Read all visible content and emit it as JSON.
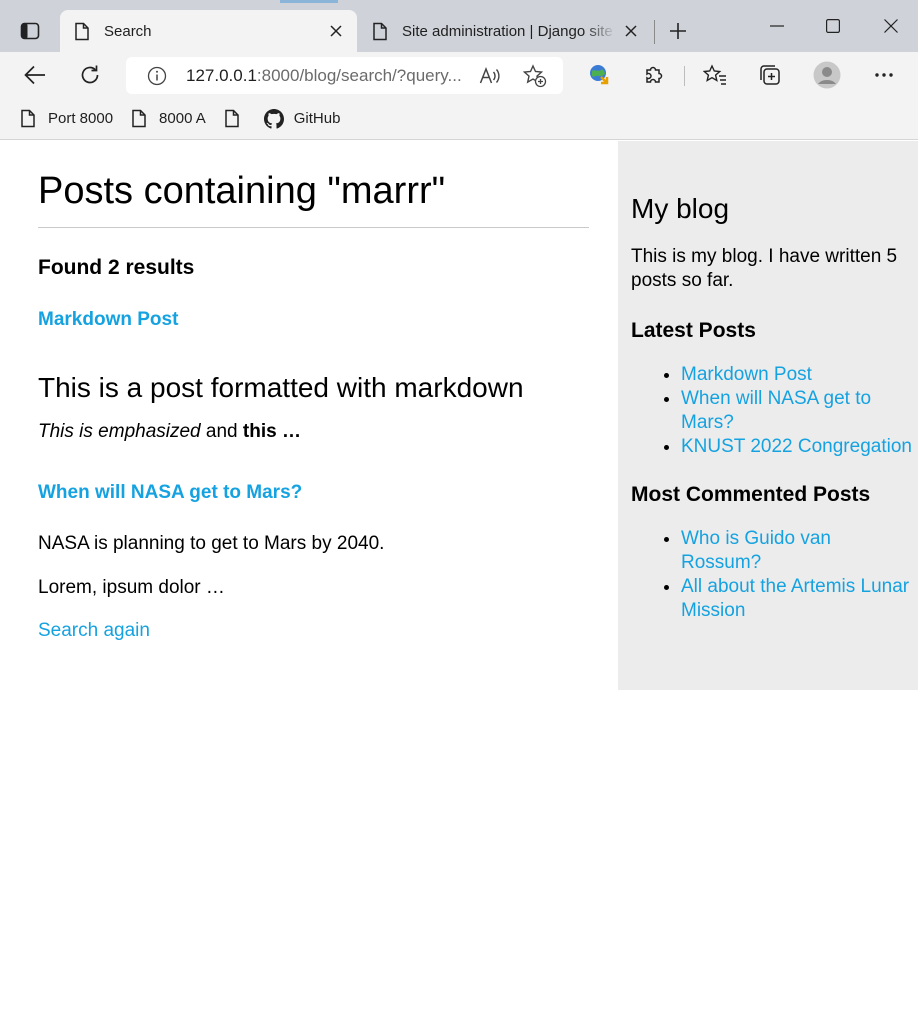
{
  "browser": {
    "tabs": [
      {
        "title": "Search",
        "active": true
      },
      {
        "title": "Site administration | Django site admin",
        "active": false
      }
    ],
    "address": {
      "host": "127.0.0.1",
      "rest": ":8000/blog/search/?query..."
    },
    "bookmarks": [
      {
        "label": "Port 8000",
        "icon": "page-icon"
      },
      {
        "label": "8000 A",
        "icon": "page-icon"
      },
      {
        "label": "",
        "icon": "page-icon"
      },
      {
        "label": "GitHub",
        "icon": "github-icon"
      }
    ]
  },
  "main": {
    "heading": "Posts containing \"marrr\"",
    "results_count": "Found 2 results",
    "results": [
      {
        "title": "Markdown Post",
        "body_heading": "This is a post formatted with markdown",
        "excerpt_em": "This is emphasized",
        "excerpt_mid": " and ",
        "excerpt_strong": "this …"
      },
      {
        "title": "When will NASA get to Mars?",
        "para1": "NASA is planning to get to Mars by 2040.",
        "para2": "Lorem, ipsum dolor …"
      }
    ],
    "search_again": "Search again"
  },
  "sidebar": {
    "title": "My blog",
    "intro": "This is my blog. I have written 5 posts so far.",
    "latest_heading": "Latest Posts",
    "latest": [
      "Markdown Post",
      "When will NASA get to Mars?",
      "KNUST 2022 Congregation"
    ],
    "commented_heading": "Most Commented Posts",
    "commented": [
      "Who is Guido van Rossum?",
      "All about the Artemis Lunar Mission"
    ]
  },
  "colors": {
    "link": "#15a2e0",
    "sidebar_bg": "#ececec"
  }
}
